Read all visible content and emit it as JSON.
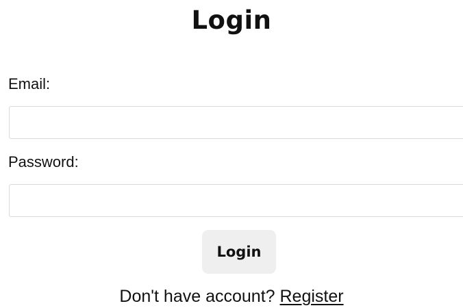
{
  "header": {
    "title": "Login"
  },
  "form": {
    "email_label": "Email:",
    "email_value": "",
    "email_placeholder": "",
    "password_label": "Password:",
    "password_value": "",
    "password_placeholder": "",
    "submit_label": "Login"
  },
  "footer": {
    "prompt_text": "Don't have account? ",
    "register_link_text": "Register"
  },
  "colors": {
    "button_bg": "#efefef",
    "input_border": "#d9d9d9",
    "text": "#111111"
  }
}
